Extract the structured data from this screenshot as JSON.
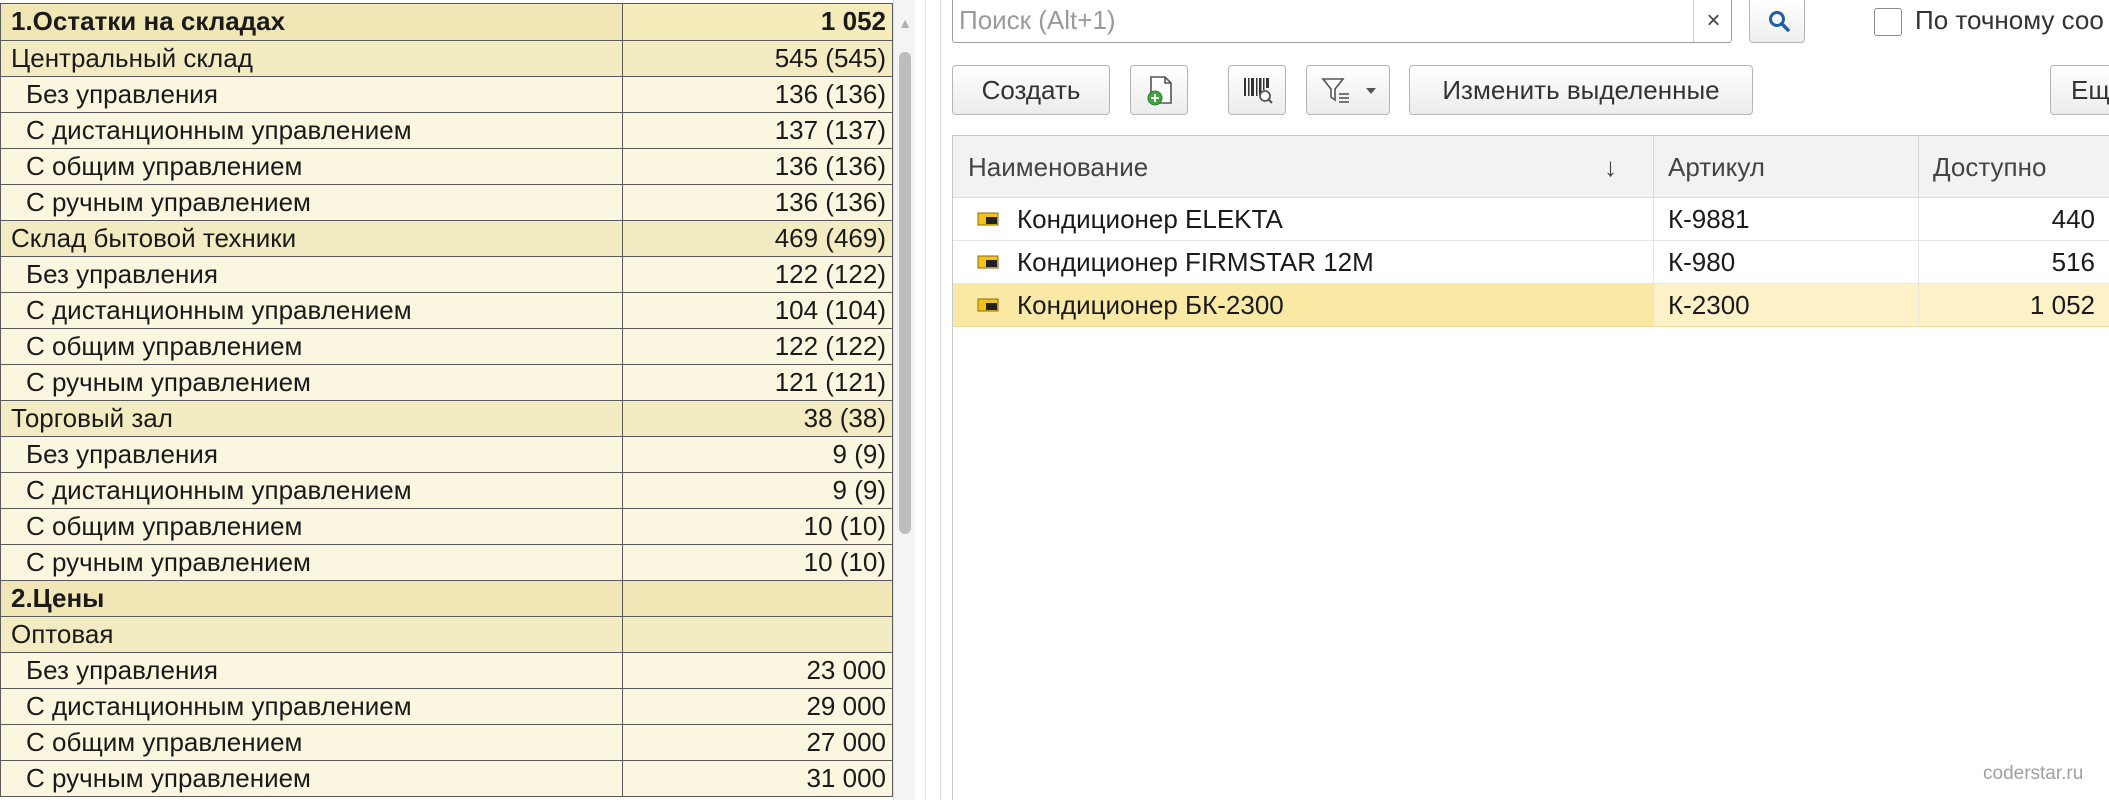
{
  "report": {
    "rows": [
      {
        "kind": "head",
        "name": "1.Остатки на складах",
        "value": "1 052"
      },
      {
        "kind": "group",
        "name": "Центральный склад",
        "value": "545 (545)"
      },
      {
        "kind": "item",
        "name": "Без управления",
        "value": "136 (136)"
      },
      {
        "kind": "item",
        "name": "С дистанционным управлением",
        "value": "137 (137)"
      },
      {
        "kind": "item",
        "name": "С общим управлением",
        "value": "136 (136)"
      },
      {
        "kind": "item",
        "name": "С ручным управлением",
        "value": "136 (136)"
      },
      {
        "kind": "group",
        "name": "Склад бытовой техники",
        "value": "469 (469)"
      },
      {
        "kind": "item",
        "name": "Без управления",
        "value": "122 (122)"
      },
      {
        "kind": "item",
        "name": "С дистанционным управлением",
        "value": "104 (104)"
      },
      {
        "kind": "item",
        "name": "С общим управлением",
        "value": "122 (122)"
      },
      {
        "kind": "item",
        "name": "С ручным управлением",
        "value": "121 (121)"
      },
      {
        "kind": "group",
        "name": "Торговый зал",
        "value": "38 (38)"
      },
      {
        "kind": "item",
        "name": "Без управления",
        "value": "9 (9)"
      },
      {
        "kind": "item",
        "name": "С дистанционным управлением",
        "value": "9 (9)"
      },
      {
        "kind": "item",
        "name": "С общим управлением",
        "value": "10 (10)"
      },
      {
        "kind": "item",
        "name": "С ручным управлением",
        "value": "10 (10)"
      },
      {
        "kind": "section",
        "name": "2.Цены",
        "value": ""
      },
      {
        "kind": "group",
        "name": "Оптовая",
        "value": ""
      },
      {
        "kind": "item",
        "name": "Без управления",
        "value": "23 000"
      },
      {
        "kind": "item",
        "name": "С дистанционным управлением",
        "value": "29 000"
      },
      {
        "kind": "item",
        "name": "С общим управлением",
        "value": "27 000"
      },
      {
        "kind": "item",
        "name": "С ручным управлением",
        "value": "31 000"
      }
    ]
  },
  "search": {
    "placeholder": "Поиск (Alt+1)",
    "value": "",
    "clear_glyph": "×",
    "exact_match_label": "По точному соо"
  },
  "toolbar": {
    "create_label": "Создать",
    "edit_selected_label": "Изменить выделенные",
    "more_label": "Ещ"
  },
  "grid": {
    "columns": {
      "name": "Наименование",
      "sort_glyph": "↓",
      "article": "Артикул",
      "available": "Доступно"
    },
    "rows": [
      {
        "name": "Кондиционер ELEKTA",
        "article": "К-9881",
        "available": "440",
        "selected": false
      },
      {
        "name": "Кондиционер FIRMSTAR 12M",
        "article": "К-980",
        "available": "516",
        "selected": false
      },
      {
        "name": "Кондиционер БК-2300",
        "article": "К-2300",
        "available": "1 052",
        "selected": true
      }
    ]
  },
  "watermark": "coderstar.ru",
  "colors": {
    "selected_row": "#fae9a4",
    "report_head": "#f1e7b6",
    "report_item": "#fbf6e0",
    "search_icon": "#1f5fa8"
  }
}
